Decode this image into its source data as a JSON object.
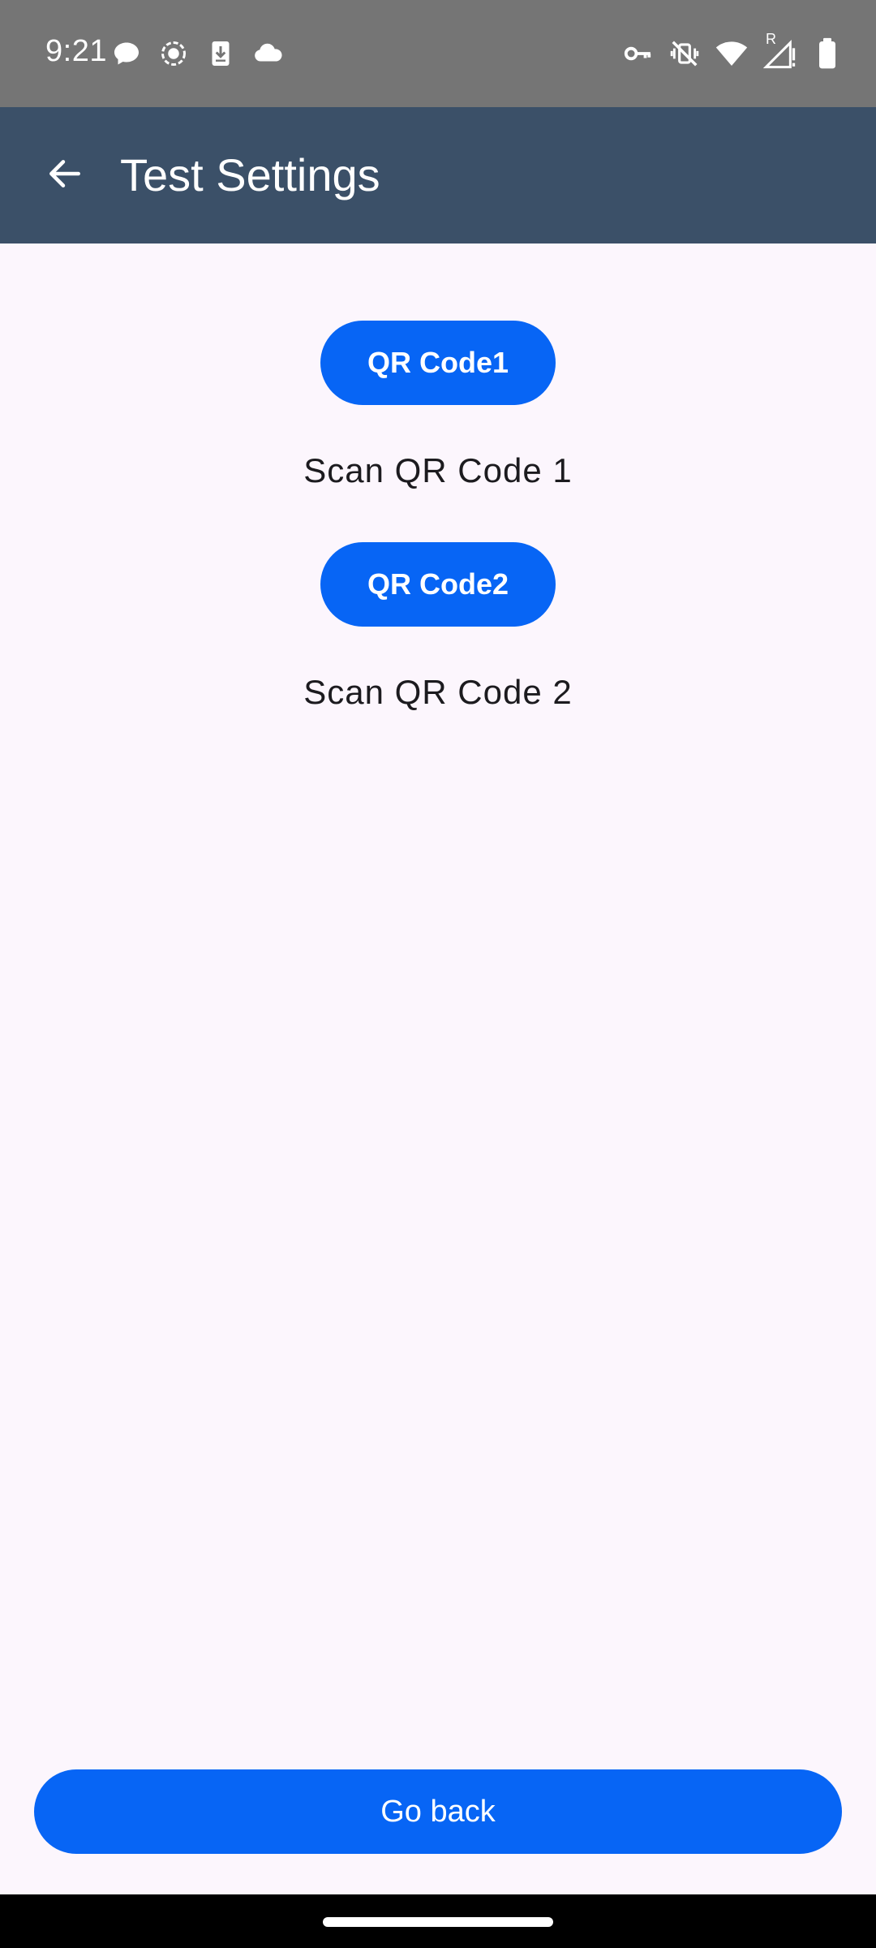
{
  "status_bar": {
    "time": "9:21",
    "left_icons": [
      "chat-bubble-icon",
      "screen-record-icon",
      "download-icon",
      "cloud-icon"
    ],
    "right_icons": [
      "vpn-key-icon",
      "vibrate-off-icon",
      "wifi-icon",
      "signal-roaming-icon",
      "battery-icon"
    ],
    "roaming_indicator": "R"
  },
  "app_bar": {
    "back_icon": "arrow-back-icon",
    "title": "Test Settings"
  },
  "content": {
    "qr1_button_label": "QR Code1",
    "qr1_caption": "Scan QR Code 1",
    "qr2_button_label": "QR Code2",
    "qr2_caption": "Scan QR Code 2",
    "go_back_label": "Go back"
  },
  "colors": {
    "status_bar": "#757575",
    "app_bar": "#3b5068",
    "accent": "#0765f5",
    "background": "#fcf6fd"
  }
}
